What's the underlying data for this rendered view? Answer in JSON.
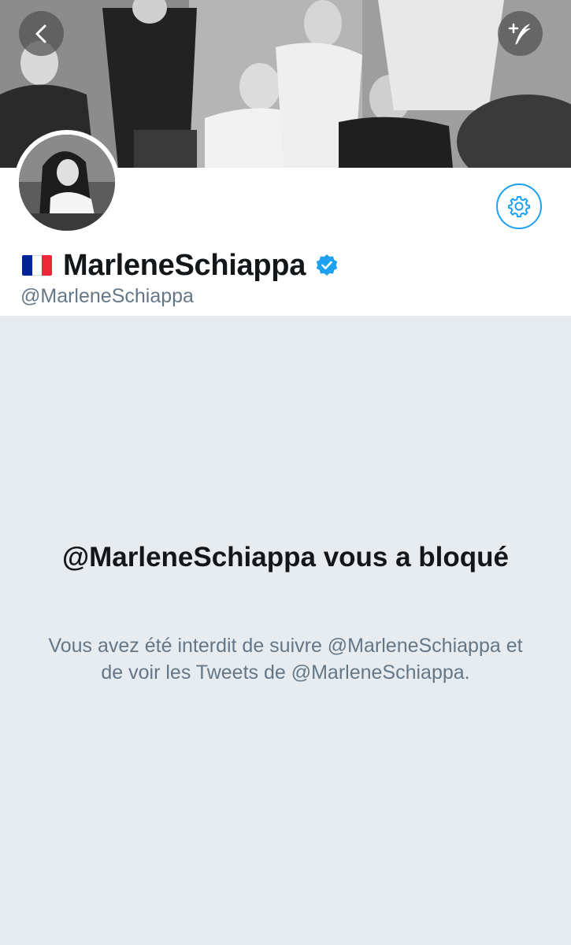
{
  "header": {
    "back_icon": "chevron-left-icon",
    "compose_icon": "compose-tweet-icon"
  },
  "profile": {
    "flag_emoji": "🇫🇷",
    "flag_colors": [
      "#002395",
      "#ffffff",
      "#ed2939"
    ],
    "display_name": "MarleneSchiappa",
    "verified": true,
    "handle": "@MarleneSchiappa",
    "settings_icon": "gear-icon"
  },
  "blocked": {
    "title": "@MarleneSchiappa vous a bloqué",
    "description": "Vous avez été interdit de suivre @MarleneSchiappa et de voir les Tweets de @MarleneSchiappa."
  },
  "colors": {
    "accent": "#1da1f2",
    "text_primary": "#14171a",
    "text_secondary": "#657786",
    "background": "#e6ecf0"
  }
}
